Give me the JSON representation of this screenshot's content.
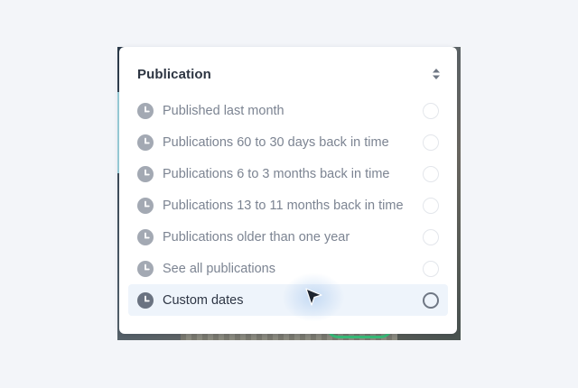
{
  "dropdown": {
    "title": "Publication",
    "options": [
      {
        "label": "Published last month",
        "icon": "clock-icon",
        "selected": false
      },
      {
        "label": "Publications 60 to 30 days back in time",
        "icon": "clock-icon",
        "selected": false
      },
      {
        "label": "Publications 6 to 3 months back in time",
        "icon": "clock-icon",
        "selected": false
      },
      {
        "label": "Publications 13 to 11 months back in time",
        "icon": "clock-icon",
        "selected": false
      },
      {
        "label": "Publications older than one year",
        "icon": "clock-icon",
        "selected": false
      },
      {
        "label": "See all publications",
        "icon": "clock-icon",
        "selected": false
      },
      {
        "label": "Custom dates",
        "icon": "clock-icon",
        "selected": false,
        "hovered": true
      }
    ]
  },
  "colors": {
    "title": "#2d3542",
    "option_text": "#7c8492",
    "icon_fill": "#a3a9b3",
    "icon_fill_active": "#6a7381",
    "hover_bg": "#eef4fb"
  }
}
